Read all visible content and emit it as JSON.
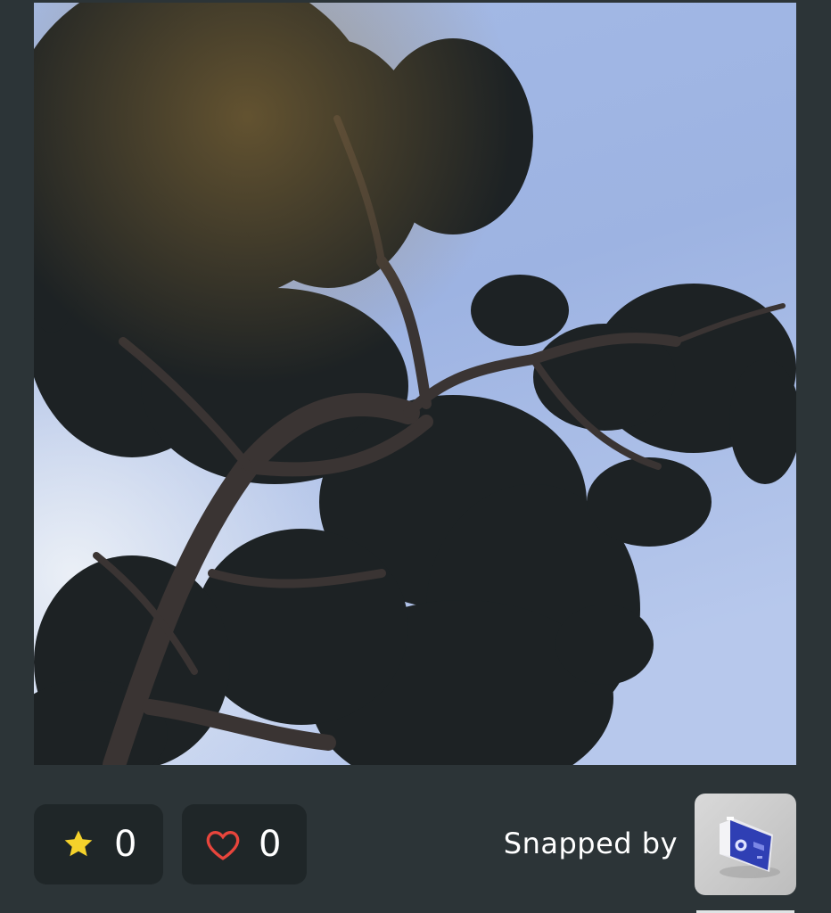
{
  "photo": {
    "alt_icon": "tree-photo",
    "sky_color_top": "#9fb6e3",
    "sky_color_bottom": "#c5d3ee"
  },
  "stats": {
    "stars": {
      "icon": "star-icon",
      "count": "0",
      "color": "#f5d22b"
    },
    "likes": {
      "icon": "heart-icon",
      "count": "0",
      "color": "#e8453c"
    }
  },
  "author": {
    "label": "Snapped by",
    "avatar_icon": "camera-avatar-icon",
    "avatar_accent": "#2f3fb4"
  },
  "colors": {
    "background": "#2c3437",
    "pill": "#1f2628",
    "text": "#ffffff"
  }
}
